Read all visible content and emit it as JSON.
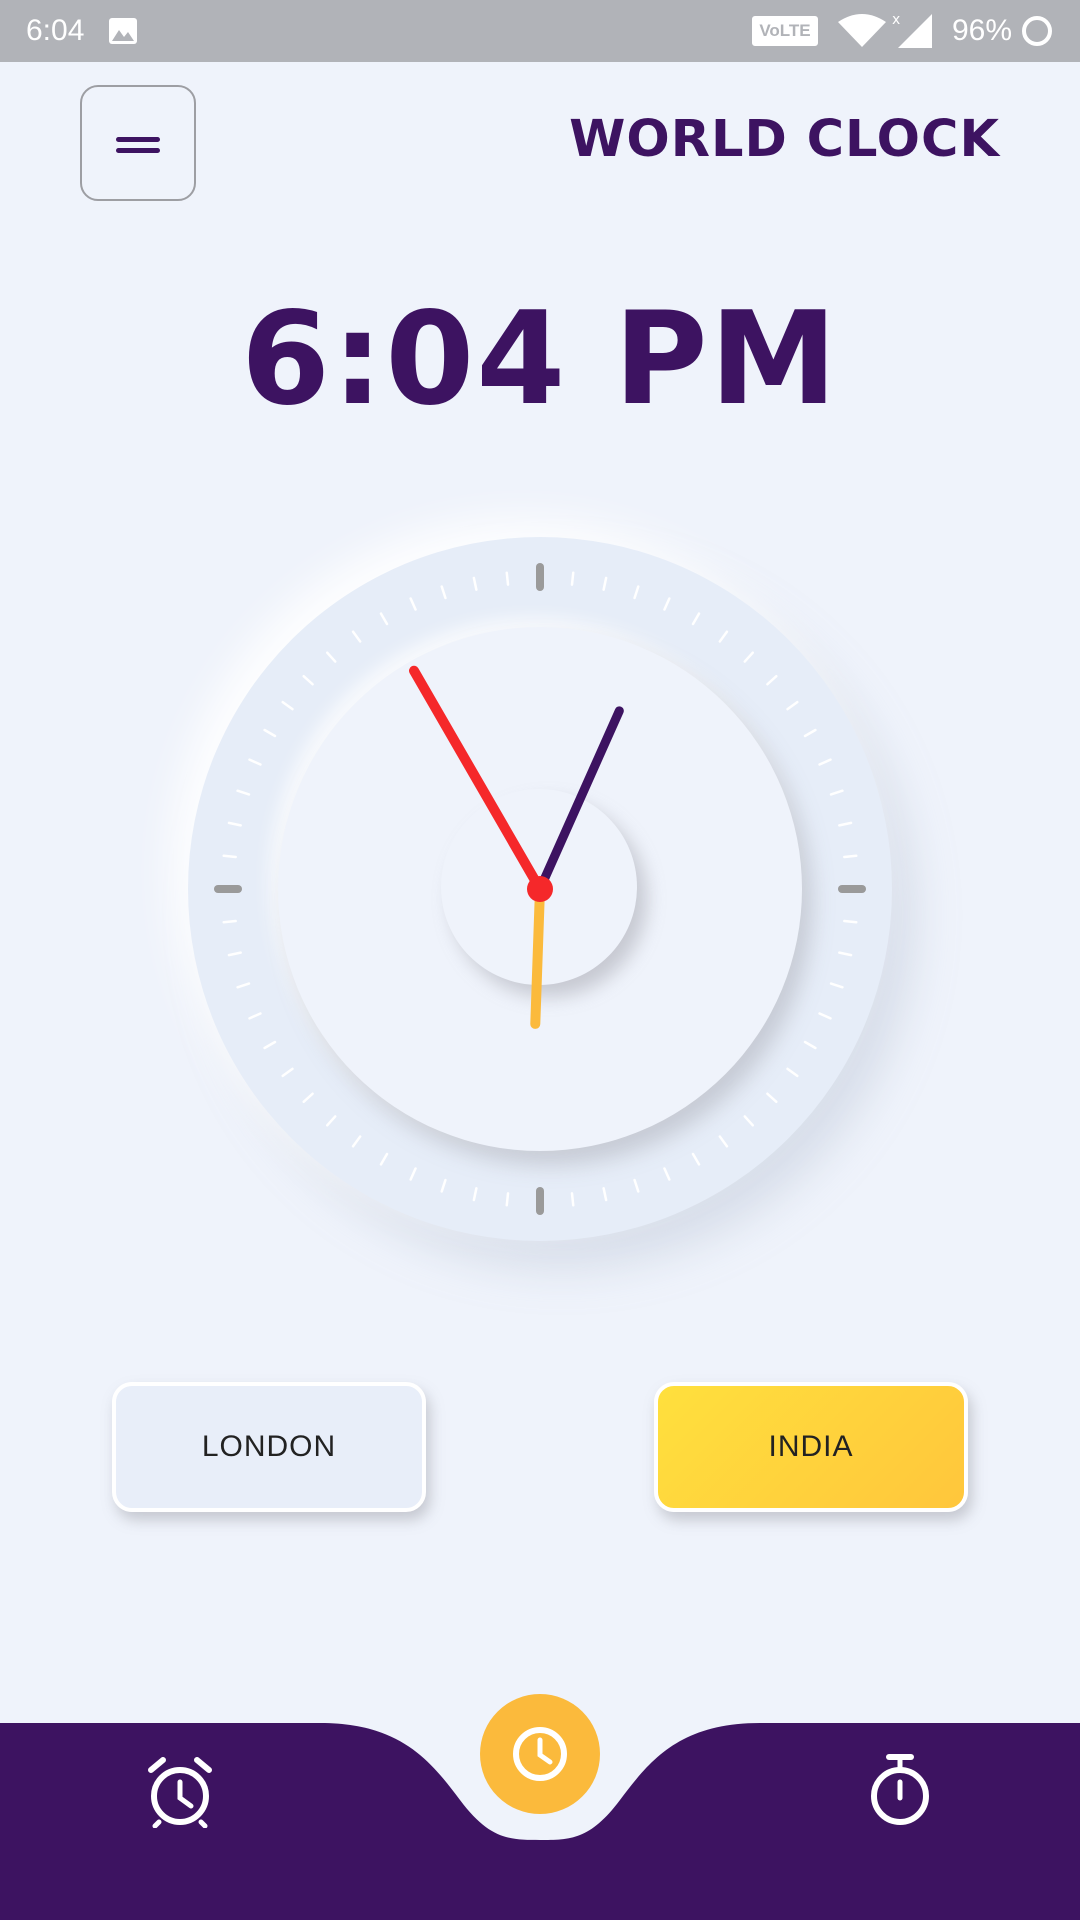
{
  "status_bar": {
    "time": "6:04",
    "network_badge": "VoLTE",
    "battery_percent": "96%",
    "icons": [
      "image-icon",
      "wifi-icon",
      "signal-icon",
      "battery-ring-icon"
    ]
  },
  "header": {
    "title": "WORLD CLOCK",
    "menu_icon": "menu-icon"
  },
  "clock": {
    "digital_time": "6:04 PM",
    "analog": {
      "hour": 6,
      "minute": 4,
      "second": 55
    },
    "colors": {
      "hour_hand": "#fbba3c",
      "minute_hand": "#3d1361",
      "second_hand": "#f5282a",
      "major_tick": "#9a9a9a",
      "minor_tick": "#ffffff"
    }
  },
  "cities": [
    {
      "label": "LONDON",
      "selected": false
    },
    {
      "label": "INDIA",
      "selected": true
    }
  ],
  "bottom_nav": {
    "items": [
      {
        "icon": "alarm-icon",
        "active": false
      },
      {
        "icon": "clock-icon",
        "active": true
      },
      {
        "icon": "stopwatch-icon",
        "active": false
      }
    ],
    "colors": {
      "background": "#3d1361",
      "active": "#fbba3c",
      "icon": "#ffffff"
    }
  },
  "theme": {
    "background": "#eff3fb",
    "primary": "#3d1361",
    "accent": "#fbba3c"
  }
}
